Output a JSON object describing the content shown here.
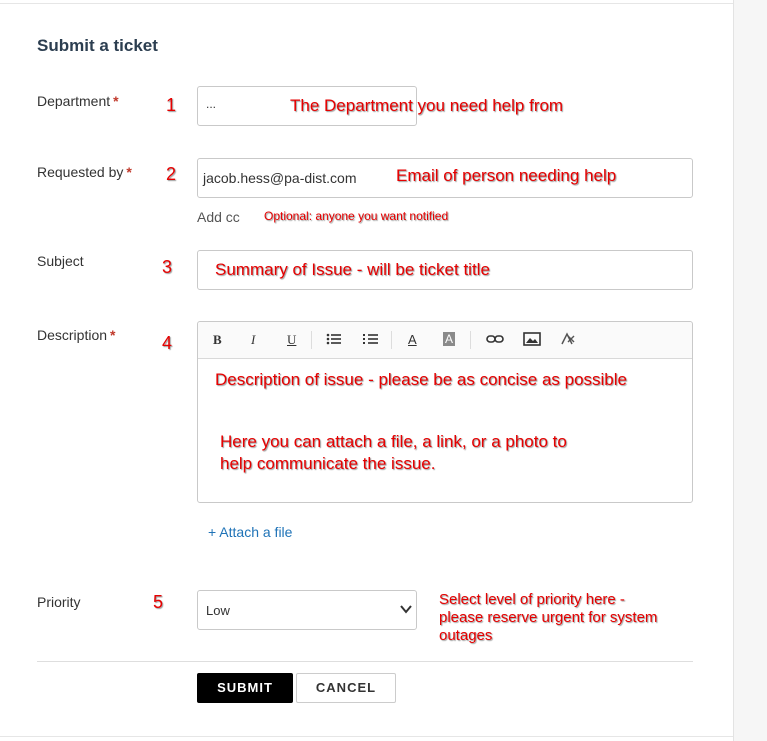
{
  "form": {
    "title": "Submit a ticket",
    "department": {
      "label": "Department",
      "value": "..."
    },
    "requested_by": {
      "label": "Requested by",
      "value": "jacob.hess@pa-dist.com",
      "add_cc": "Add cc"
    },
    "subject": {
      "label": "Subject"
    },
    "description": {
      "label": "Description"
    },
    "attach": "+ Attach a file",
    "priority": {
      "label": "Priority",
      "value": "Low"
    },
    "submit": "SUBMIT",
    "cancel": "CANCEL"
  },
  "toolbar": {
    "bold": "B",
    "italic": "I",
    "underline": "U",
    "text_color": "A",
    "bg_color": "A"
  },
  "annotations": {
    "n1": "1",
    "n2": "2",
    "n3": "3",
    "n4": "4",
    "n5": "5",
    "a1": "The Department you need help from",
    "a2": "Email of person needing help",
    "a2b": "Optional: anyone you want notified",
    "a3": "Summary of Issue - will be ticket title",
    "a4": "Description of issue - please be as concise as possible",
    "a4b_line1": "Here you can attach a file, a link, or a photo to",
    "a4b_line2": "help communicate the issue.",
    "a5_line1": "Select level of priority here -",
    "a5_line2": "please reserve urgent for system",
    "a5_line3": "outages"
  },
  "colors": {
    "annotation": "#e60000",
    "required": "#c0392b",
    "link": "#1f73b7",
    "submit_bg": "#000000"
  },
  "icons": [
    "bold-icon",
    "italic-icon",
    "underline-icon",
    "bullet-list-icon",
    "numbered-list-icon",
    "text-color-icon",
    "background-color-icon",
    "link-icon",
    "image-icon",
    "clear-format-icon",
    "chevron-down-icon"
  ]
}
